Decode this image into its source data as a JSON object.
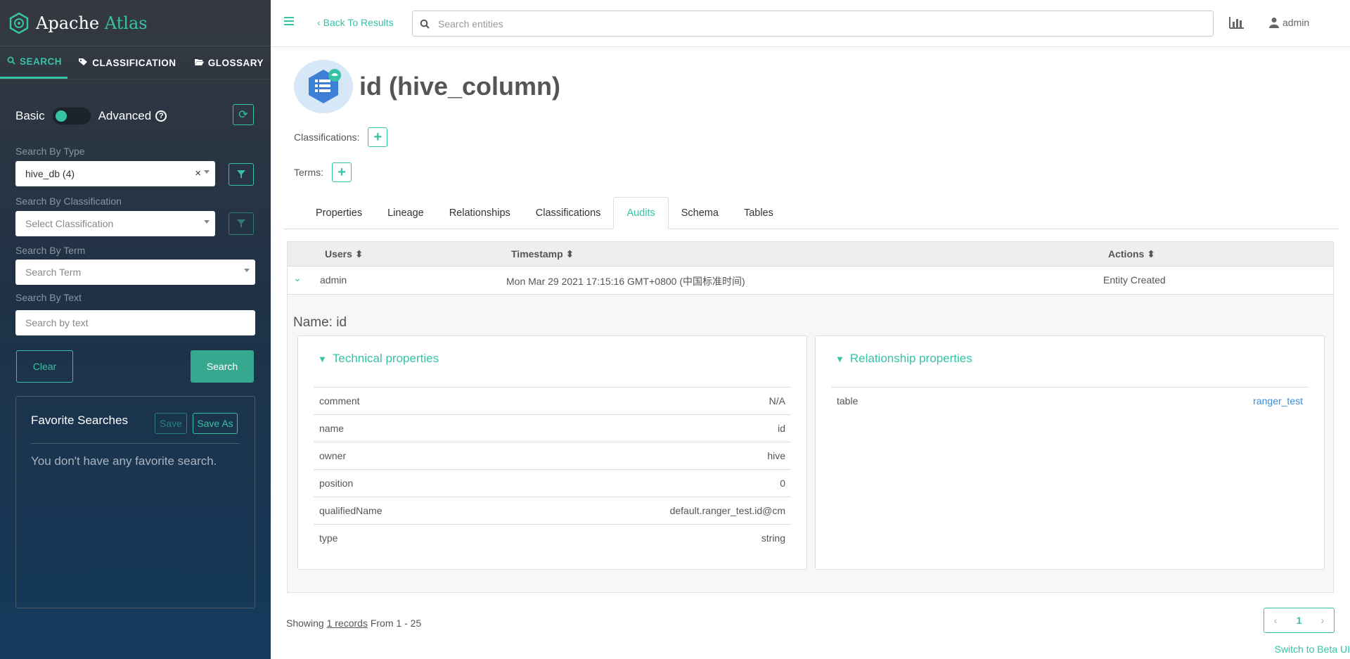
{
  "brand": {
    "name_part1": "Apache",
    "name_part2": "Atlas"
  },
  "sidebar": {
    "tabs": [
      {
        "label": "SEARCH",
        "icon": "search-icon",
        "active": true
      },
      {
        "label": "CLASSIFICATION",
        "icon": "tag-icon",
        "active": false
      },
      {
        "label": "GLOSSARY",
        "icon": "folder-open-icon",
        "active": false
      }
    ],
    "toggle": {
      "left_label": "Basic",
      "right_label": "Advanced"
    },
    "filters": {
      "type_label": "Search By Type",
      "type_value": "hive_db (4)",
      "classification_label": "Search By Classification",
      "classification_placeholder": "Select Classification",
      "term_label": "Search By Term",
      "term_placeholder": "Search Term",
      "text_label": "Search By Text",
      "text_placeholder": "Search by text"
    },
    "buttons": {
      "clear": "Clear",
      "search": "Search"
    },
    "favorites": {
      "title": "Favorite Searches",
      "save": "Save",
      "save_as": "Save As",
      "empty": "You don't have any favorite search."
    }
  },
  "topbar": {
    "back": "Back To Results",
    "search_placeholder": "Search entities",
    "user": "admin"
  },
  "entity": {
    "title": "id (hive_column)",
    "classifications_label": "Classifications:",
    "terms_label": "Terms:"
  },
  "tabs": [
    "Properties",
    "Lineage",
    "Relationships",
    "Classifications",
    "Audits",
    "Schema",
    "Tables"
  ],
  "active_tab": "Audits",
  "audits": {
    "columns": {
      "users": "Users",
      "timestamp": "Timestamp",
      "actions": "Actions"
    },
    "row": {
      "user": "admin",
      "timestamp": "Mon Mar 29 2021 17:15:16 GMT+0800 (中国标准时间)",
      "action": "Entity Created"
    },
    "name_line": "Name: id",
    "technical": {
      "title": "Technical properties",
      "rows": [
        {
          "key": "comment",
          "value": "N/A"
        },
        {
          "key": "name",
          "value": "id"
        },
        {
          "key": "owner",
          "value": "hive"
        },
        {
          "key": "position",
          "value": "0"
        },
        {
          "key": "qualifiedName",
          "value": "default.ranger_test.id@cm"
        },
        {
          "key": "type",
          "value": "string"
        }
      ]
    },
    "relationship": {
      "title": "Relationship properties",
      "rows": [
        {
          "key": "table",
          "value": "ranger_test"
        }
      ]
    }
  },
  "footer": {
    "showing_prefix": "Showing ",
    "records_link": "1 records",
    "showing_suffix": " From 1 - 25",
    "page": "1",
    "beta_link": "Switch to Beta UI"
  },
  "colors": {
    "accent": "#36c2a5",
    "link": "#3a8dd8",
    "sidebar_top": "#35393f",
    "sidebar_bottom": "#133a5c"
  }
}
